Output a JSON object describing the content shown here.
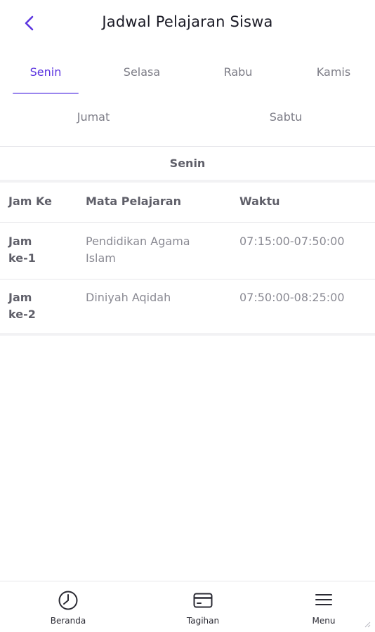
{
  "header": {
    "title": "Jadwal Pelajaran Siswa",
    "back_icon": "chevron-left-icon"
  },
  "tabs": [
    {
      "label": "Senin",
      "active": true
    },
    {
      "label": "Selasa",
      "active": false
    },
    {
      "label": "Rabu",
      "active": false
    },
    {
      "label": "Kamis",
      "active": false
    },
    {
      "label": "Jumat",
      "active": false
    },
    {
      "label": "Sabtu",
      "active": false
    }
  ],
  "selected_day": "Senin",
  "schedule": {
    "columns": [
      "Jam Ke",
      "Mata Pelajaran",
      "Waktu"
    ],
    "rows": [
      {
        "jam": [
          "Jam",
          "ke-1"
        ],
        "mapel": [
          "Pendidikan Agama",
          "Islam"
        ],
        "waktu": "07:15:00-07:50:00"
      },
      {
        "jam": [
          "Jam",
          "ke-2"
        ],
        "mapel": [
          "Diniyah Aqidah"
        ],
        "waktu": "07:50:00-08:25:00"
      }
    ]
  },
  "bottom_nav": [
    {
      "label": "Beranda",
      "icon": "clock-icon"
    },
    {
      "label": "Tagihan",
      "icon": "card-icon"
    },
    {
      "label": "Menu",
      "icon": "hamburger-menu-icon"
    }
  ],
  "colors": {
    "accent": "#5b34e0",
    "tab_underline": "#9a86ee",
    "muted_text": "#8a8a93",
    "divider": "#e6e6ea"
  }
}
